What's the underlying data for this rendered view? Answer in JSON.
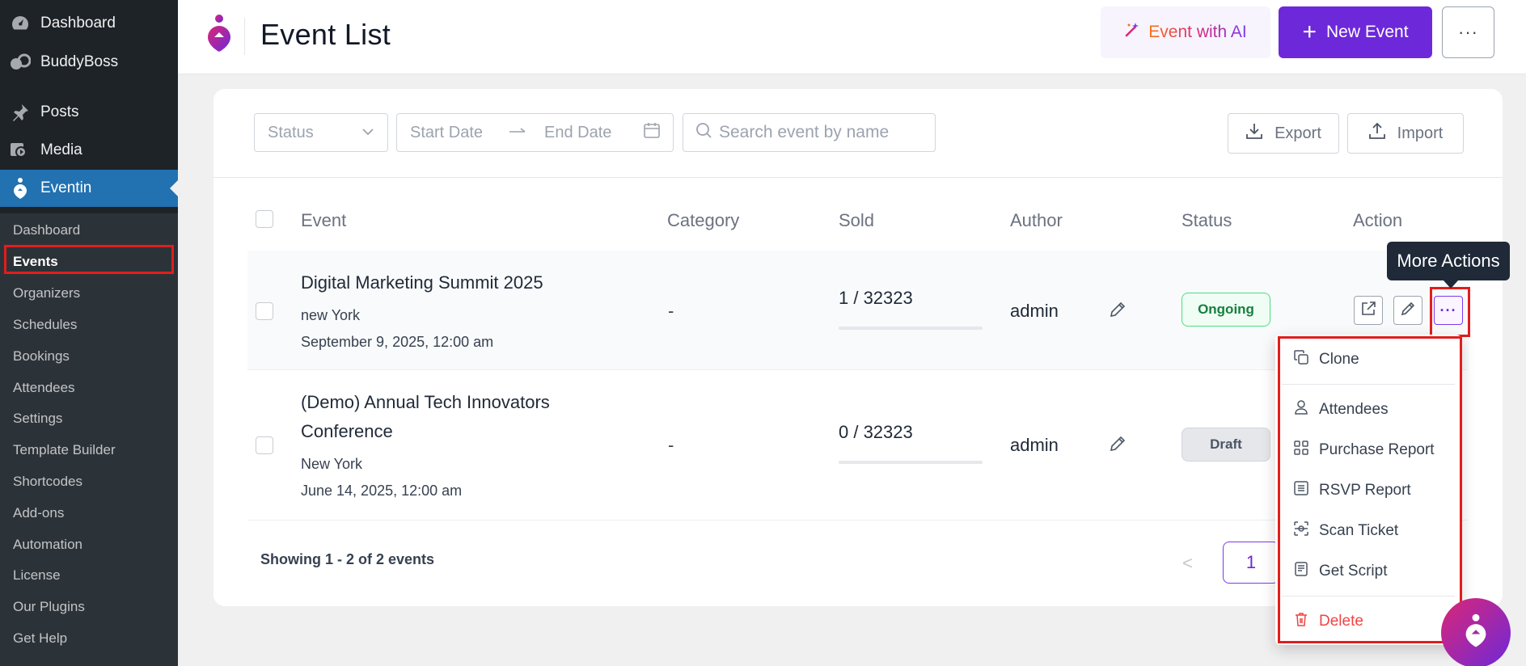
{
  "sidebar": {
    "top_items": [
      {
        "label": "Dashboard",
        "icon": "dashboard-icon"
      },
      {
        "label": "BuddyBoss",
        "icon": "buddyboss-icon"
      },
      {
        "label": "Posts",
        "icon": "pin-icon"
      },
      {
        "label": "Media",
        "icon": "media-icon"
      },
      {
        "label": "Eventin",
        "icon": "eventin-icon",
        "active": true
      }
    ],
    "sub_items": [
      {
        "label": "Dashboard"
      },
      {
        "label": "Events",
        "current": true
      },
      {
        "label": "Organizers"
      },
      {
        "label": "Schedules"
      },
      {
        "label": "Bookings"
      },
      {
        "label": "Attendees"
      },
      {
        "label": "Settings"
      },
      {
        "label": "Template Builder"
      },
      {
        "label": "Shortcodes"
      },
      {
        "label": "Add-ons"
      },
      {
        "label": "Automation"
      },
      {
        "label": "License"
      },
      {
        "label": "Our Plugins"
      },
      {
        "label": "Get Help"
      }
    ]
  },
  "header": {
    "title": "Event List",
    "ai_button": "Event with AI",
    "new_button": "New Event",
    "more_button": "···"
  },
  "filters": {
    "status_placeholder": "Status",
    "start_date_placeholder": "Start Date",
    "end_date_placeholder": "End Date",
    "search_placeholder": "Search event by name",
    "export_label": "Export",
    "import_label": "Import"
  },
  "table": {
    "columns": [
      "Event",
      "Category",
      "Sold",
      "Author",
      "Status",
      "Action"
    ],
    "rows": [
      {
        "title": "Digital Marketing Summit 2025",
        "location": "new York",
        "date": "September 9, 2025, 12:00 am",
        "category": "-",
        "sold": "1 / 32323",
        "sold_fraction": 3e-05,
        "author": "admin",
        "status": "Ongoing"
      },
      {
        "title": "(Demo) Annual Tech Innovators Conference",
        "location": "New York",
        "date": "June 14, 2025, 12:00 am",
        "category": "-",
        "sold": "0 / 32323",
        "sold_fraction": 0,
        "author": "admin",
        "status": "Draft"
      }
    ]
  },
  "footer": {
    "showing": "Showing 1 - 2 of 2 events",
    "prev": "<",
    "current_page": "1"
  },
  "tooltip": "More Actions",
  "action_menu": {
    "items": [
      {
        "label": "Clone",
        "icon": "clone-icon"
      },
      {
        "label": "Attendees",
        "icon": "user-icon"
      },
      {
        "label": "Purchase Report",
        "icon": "grid-icon"
      },
      {
        "label": "RSVP Report",
        "icon": "list-icon"
      },
      {
        "label": "Scan Ticket",
        "icon": "scan-icon"
      },
      {
        "label": "Get Script",
        "icon": "script-icon"
      },
      {
        "label": "Delete",
        "icon": "trash-icon",
        "danger": true
      }
    ]
  },
  "colors": {
    "wp_sidebar": "#1d2327",
    "wp_active": "#2271b1",
    "accent": "#6d28d9",
    "highlight": "#e11d1d",
    "ongoing": "#15803d",
    "danger": "#ef4444"
  }
}
